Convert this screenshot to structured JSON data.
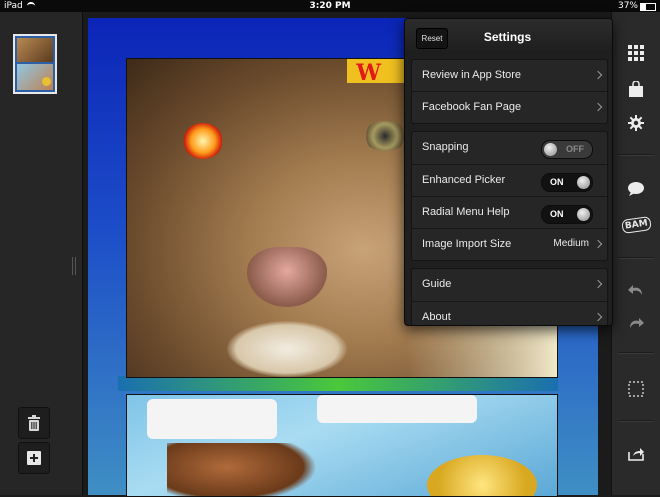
{
  "status_bar": {
    "device": "iPad",
    "time": "3:20 PM",
    "battery": "37%"
  },
  "settings": {
    "title": "Settings",
    "reset_label": "Reset",
    "group1": [
      {
        "label": "Review in App Store"
      },
      {
        "label": "Facebook Fan Page"
      }
    ],
    "group2": [
      {
        "label": "Snapping",
        "state": "OFF"
      },
      {
        "label": "Enhanced Picker",
        "state": "ON"
      },
      {
        "label": "Radial Menu Help",
        "state": "ON"
      },
      {
        "label": "Image Import Size",
        "value": "Medium"
      }
    ],
    "group3": [
      {
        "label": "Guide"
      },
      {
        "label": "About"
      }
    ]
  },
  "comic": {
    "caption_text": "W"
  },
  "icons": {
    "left_toolbar": [
      "trash-icon",
      "add-icon"
    ],
    "right_toolbar": [
      "grid-icon",
      "shopping-bag-icon",
      "gear-icon",
      "speech-bubble-icon",
      "bam-sticker-icon",
      "undo-icon",
      "redo-icon",
      "crop-icon",
      "share-icon"
    ],
    "bam_label": "BAM"
  },
  "colors": {
    "canvas_top": "#0b25b8",
    "canvas_bottom": "#3f8fc4",
    "popover_bg": "#1f1f1f",
    "toggle_on": "#121212"
  }
}
